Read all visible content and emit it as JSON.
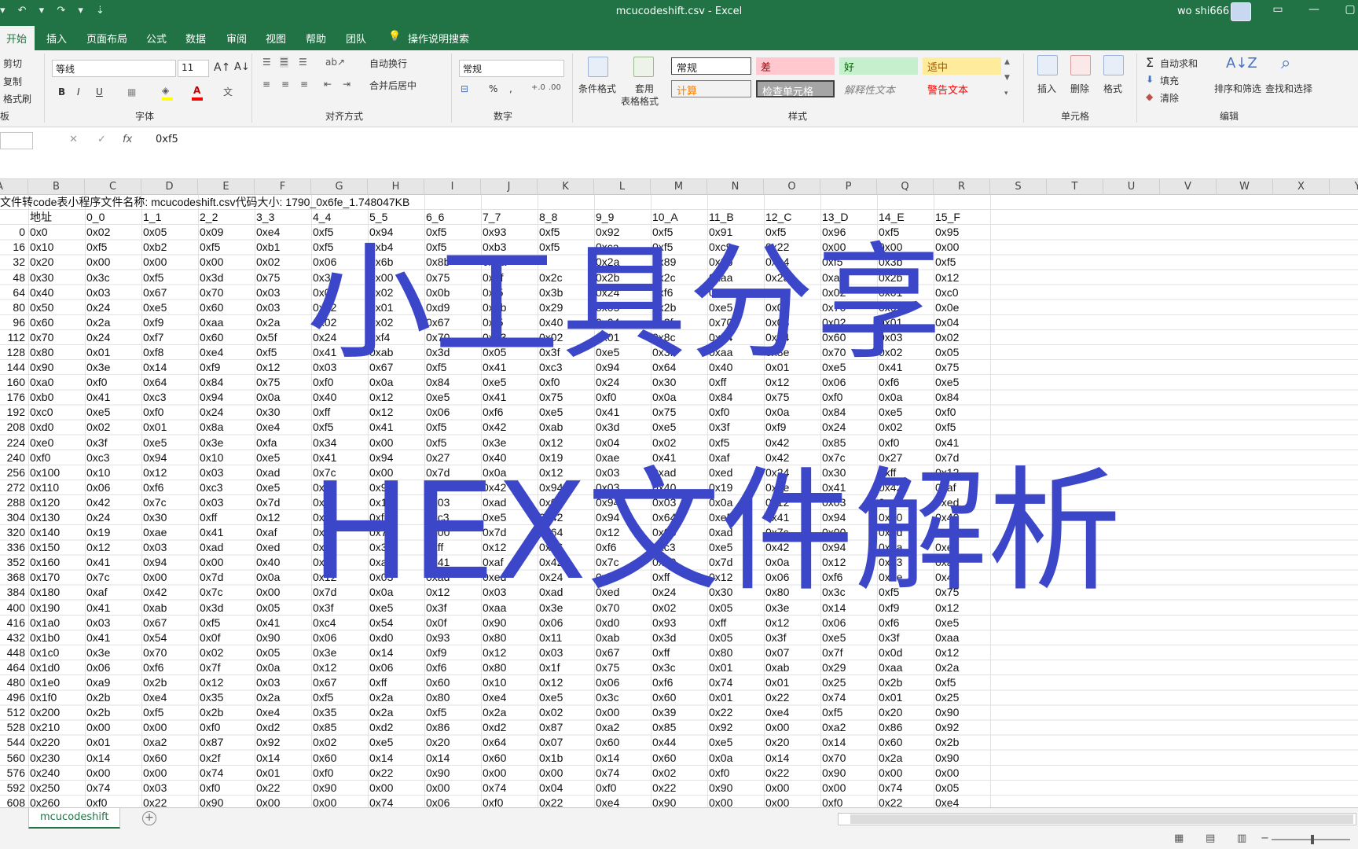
{
  "window": {
    "title": "mcucodeshift.csv  -  Excel",
    "user": "wo shi666",
    "qat": "▾ ↶ ▾ ↷ ▾ ⇣"
  },
  "ribbon_tabs": [
    {
      "label": "开始",
      "active": true
    },
    {
      "label": "插入"
    },
    {
      "label": "页面布局"
    },
    {
      "label": "公式"
    },
    {
      "label": "数据"
    },
    {
      "label": "审阅"
    },
    {
      "label": "视图"
    },
    {
      "label": "帮助"
    },
    {
      "label": "团队"
    },
    {
      "label": "操作说明搜索"
    }
  ],
  "ribbon": {
    "clipboard": {
      "cut": "剪切",
      "copy": "复制",
      "painter": "格式刷",
      "group": "板"
    },
    "font": {
      "name": "等线",
      "size": "11",
      "group": "字体",
      "bold": "B",
      "italic": "I",
      "underline": "U"
    },
    "align": {
      "wrap": "自动换行",
      "merge": "合并后居中",
      "group": "对齐方式"
    },
    "number": {
      "format": "常规",
      "group": "数字",
      "percent": "%",
      "comma": ","
    },
    "styles": {
      "conditional": "条件格式",
      "table_format_1": "套用",
      "table_format_2": "表格格式",
      "normal": "常规",
      "bad": "差",
      "good": "好",
      "neutral": "适中",
      "calc": "计算",
      "check": "检查单元格",
      "explain": "解释性文本",
      "warning": "警告文本",
      "group": "样式"
    },
    "cells": {
      "insert": "插入",
      "delete": "删除",
      "format": "格式",
      "group": "单元格"
    },
    "editing": {
      "autosum": "自动求和",
      "fill": "填充",
      "clear": "清除",
      "sort": "排序和筛选",
      "find": "查找和选择",
      "group": "编辑"
    }
  },
  "formula_bar": {
    "cancel": "✕",
    "enter": "✓",
    "fx": "fx",
    "value": "0xf5"
  },
  "columns": [
    "A",
    "B",
    "C",
    "D",
    "E",
    "F",
    "G",
    "H",
    "I",
    "J",
    "K",
    "L",
    "M",
    "N",
    "O",
    "P",
    "Q",
    "R",
    "S",
    "T",
    "U",
    "V",
    "W",
    "X",
    "Y"
  ],
  "info_line": "文件转code表小程序文件名称:   mcucodeshift.csv代码大小:   1790_0x6fe_1.748047KB",
  "header_row": [
    "",
    "地址",
    "0_0",
    "1_1",
    "2_2",
    "3_3",
    "4_4",
    "5_5",
    "6_6",
    "7_7",
    "8_8",
    "9_9",
    "10_A",
    "11_B",
    "12_C",
    "13_D",
    "14_E",
    "15_F"
  ],
  "rows": [
    [
      "0",
      "0x0",
      "0x02",
      "0x05",
      "0x09",
      "0xe4",
      "0xf5",
      "0x94",
      "0xf5",
      "0x93",
      "0xf5",
      "0x92",
      "0xf5",
      "0x91",
      "0xf5",
      "0x96",
      "0xf5",
      "0x95"
    ],
    [
      "16",
      "0x10",
      "0xf5",
      "0xb2",
      "0xf5",
      "0xb1",
      "0xf5",
      "0xb4",
      "0xf5",
      "0xb3",
      "0xf5",
      "0xca",
      "0xf5",
      "0xc9",
      "0x22",
      "0x00",
      "0x00",
      "0x00"
    ],
    [
      "32",
      "0x20",
      "0x00",
      "0x00",
      "0x00",
      "0x02",
      "0x06",
      "0x6b",
      "0x8b",
      "0x2a",
      "",
      "0x2a",
      "0x89",
      "0x2b",
      "0xe4",
      "0xf5",
      "0x3b",
      "0xf5"
    ],
    [
      "48",
      "0x30",
      "0x3c",
      "0xf5",
      "0x3d",
      "0x75",
      "0x3e",
      "0x00",
      "0x75",
      "0x3f",
      "0x2c",
      "0x2b",
      "0x2c",
      "0xaa",
      "0x2a",
      "0xa9",
      "0x2b",
      "0x12"
    ],
    [
      "64",
      "0x40",
      "0x03",
      "0x67",
      "0x70",
      "0x03",
      "0x02",
      "0x02",
      "0x0b",
      "0xf5",
      "0x3b",
      "0x24",
      "0xf6",
      "0x62",
      "0x03",
      "0x02",
      "0x01",
      "0xc0"
    ],
    [
      "80",
      "0x50",
      "0x24",
      "0xe5",
      "0x60",
      "0x03",
      "0x02",
      "0x01",
      "0xd9",
      "0xab",
      "0x29",
      "0x05",
      "0x2b",
      "0xe5",
      "0x01",
      "0x70",
      "0x02",
      "0x0e"
    ],
    [
      "96",
      "0x60",
      "0x2a",
      "0xf9",
      "0xaa",
      "0x2a",
      "0x02",
      "0x02",
      "0x67",
      "0xf5",
      "0x40",
      "0x04",
      "0x2f",
      "0x70",
      "0x03",
      "0x02",
      "0x01",
      "0x04"
    ],
    [
      "112",
      "0x70",
      "0x24",
      "0xf7",
      "0x60",
      "0x5f",
      "0x24",
      "0xf4",
      "0x70",
      "0x03",
      "0x02",
      "0x01",
      "0x8c",
      "0x24",
      "0x14",
      "0x60",
      "0x03",
      "0x02"
    ],
    [
      "128",
      "0x80",
      "0x01",
      "0xf8",
      "0xe4",
      "0xf5",
      "0x41",
      "0xab",
      "0x3d",
      "0x05",
      "0x3f",
      "0xe5",
      "0x3f",
      "0xaa",
      "0x3e",
      "0x70",
      "0x02",
      "0x05"
    ],
    [
      "144",
      "0x90",
      "0x3e",
      "0x14",
      "0xf9",
      "0x12",
      "0x03",
      "0x67",
      "0xf5",
      "0x41",
      "0xc3",
      "0x94",
      "0x64",
      "0x40",
      "0x01",
      "0xe5",
      "0x41",
      "0x75"
    ],
    [
      "160",
      "0xa0",
      "0xf0",
      "0x64",
      "0x84",
      "0x75",
      "0xf0",
      "0x0a",
      "0x84",
      "0xe5",
      "0xf0",
      "0x24",
      "0x30",
      "0xff",
      "0x12",
      "0x06",
      "0xf6",
      "0xe5"
    ],
    [
      "176",
      "0xb0",
      "0x41",
      "0xc3",
      "0x94",
      "0x0a",
      "0x40",
      "0x12",
      "0xe5",
      "0x41",
      "0x75",
      "0xf0",
      "0x0a",
      "0x84",
      "0x75",
      "0xf0",
      "0x0a",
      "0x84"
    ],
    [
      "192",
      "0xc0",
      "0xe5",
      "0xf0",
      "0x24",
      "0x30",
      "0xff",
      "0x12",
      "0x06",
      "0xf6",
      "0xe5",
      "0x41",
      "0x75",
      "0xf0",
      "0x0a",
      "0x84",
      "0xe5",
      "0xf0"
    ],
    [
      "208",
      "0xd0",
      "0x02",
      "0x01",
      "0x8a",
      "0xe4",
      "0xf5",
      "0x41",
      "0xf5",
      "0x42",
      "0xab",
      "0x3d",
      "0xe5",
      "0x3f",
      "0xf9",
      "0x24",
      "0x02",
      "0xf5"
    ],
    [
      "224",
      "0xe0",
      "0x3f",
      "0xe5",
      "0x3e",
      "0xfa",
      "0x34",
      "0x00",
      "0xf5",
      "0x3e",
      "0x12",
      "0x04",
      "0x02",
      "0xf5",
      "0x42",
      "0x85",
      "0xf0",
      "0x41"
    ],
    [
      "240",
      "0xf0",
      "0xc3",
      "0x94",
      "0x10",
      "0xe5",
      "0x41",
      "0x94",
      "0x27",
      "0x40",
      "0x19",
      "0xae",
      "0x41",
      "0xaf",
      "0x42",
      "0x7c",
      "0x27",
      "0x7d"
    ],
    [
      "256",
      "0x100",
      "0x10",
      "0x12",
      "0x03",
      "0xad",
      "0x7c",
      "0x00",
      "0x7d",
      "0x0a",
      "0x12",
      "0x03",
      "0xad",
      "0xed",
      "0x24",
      "0x30",
      "0xff",
      "0x12"
    ],
    [
      "272",
      "0x110",
      "0x06",
      "0xf6",
      "0xc3",
      "0xe5",
      "0x02",
      "0x94",
      "0x40",
      "0x42",
      "0x94",
      "0x03",
      "0x40",
      "0x19",
      "0xae",
      "0x41",
      "0x42",
      "0xaf"
    ],
    [
      "288",
      "0x120",
      "0x42",
      "0x7c",
      "0x03",
      "0x7d",
      "0xe8",
      "0x12",
      "0x03",
      "0xad",
      "0x0c",
      "0x94",
      "0x03",
      "0x0a",
      "0x12",
      "0x03",
      "0xad",
      "0xed"
    ],
    [
      "304",
      "0x130",
      "0x24",
      "0x30",
      "0xff",
      "0x12",
      "0x06",
      "0xf6",
      "0xc3",
      "0xe5",
      "0x42",
      "0x94",
      "0x64",
      "0xe5",
      "0x41",
      "0x94",
      "0x00",
      "0x40"
    ],
    [
      "320",
      "0x140",
      "0x19",
      "0xae",
      "0x41",
      "0xaf",
      "0x42",
      "0x7c",
      "0x00",
      "0x7d",
      "0x64",
      "0x12",
      "0x03",
      "0xad",
      "0x7c",
      "0x00",
      "0x7d",
      "0x0a"
    ],
    [
      "336",
      "0x150",
      "0x12",
      "0x03",
      "0xad",
      "0xed",
      "0x24",
      "0x30",
      "0xff",
      "0x12",
      "0x06",
      "0xf6",
      "0xc3",
      "0xe5",
      "0x42",
      "0x94",
      "0x0a",
      "0xe5"
    ],
    [
      "352",
      "0x160",
      "0x41",
      "0x94",
      "0x00",
      "0x40",
      "0x09",
      "0xae",
      "0x41",
      "0xaf",
      "0x42",
      "0x7c",
      "0x00",
      "0x7d",
      "0x0a",
      "0x12",
      "0x03",
      "0xad"
    ],
    [
      "368",
      "0x170",
      "0x7c",
      "0x00",
      "0x7d",
      "0x0a",
      "0x12",
      "0x03",
      "0xad",
      "0xed",
      "0x24",
      "0x30",
      "0xff",
      "0x12",
      "0x06",
      "0xf6",
      "0xae",
      "0x41"
    ],
    [
      "384",
      "0x180",
      "0xaf",
      "0x42",
      "0x7c",
      "0x00",
      "0x7d",
      "0x0a",
      "0x12",
      "0x03",
      "0xad",
      "0xed",
      "0x24",
      "0x30",
      "0x80",
      "0x3c",
      "0xf5",
      "0x75"
    ],
    [
      "400",
      "0x190",
      "0x41",
      "0xab",
      "0x3d",
      "0x05",
      "0x3f",
      "0xe5",
      "0x3f",
      "0xaa",
      "0x3e",
      "0x70",
      "0x02",
      "0x05",
      "0x3e",
      "0x14",
      "0xf9",
      "0x12"
    ],
    [
      "416",
      "0x1a0",
      "0x03",
      "0x67",
      "0xf5",
      "0x41",
      "0xc4",
      "0x54",
      "0x0f",
      "0x90",
      "0x06",
      "0xd0",
      "0x93",
      "0xff",
      "0x12",
      "0x06",
      "0xf6",
      "0xe5"
    ],
    [
      "432",
      "0x1b0",
      "0x41",
      "0x54",
      "0x0f",
      "0x90",
      "0x06",
      "0xd0",
      "0x93",
      "0x80",
      "0x11",
      "0xab",
      "0x3d",
      "0x05",
      "0x3f",
      "0xe5",
      "0x3f",
      "0xaa"
    ],
    [
      "448",
      "0x1c0",
      "0x3e",
      "0x70",
      "0x02",
      "0x05",
      "0x3e",
      "0x14",
      "0xf9",
      "0x12",
      "0x03",
      "0x67",
      "0xff",
      "0x80",
      "0x07",
      "0x7f",
      "0x0d",
      "0x12"
    ],
    [
      "464",
      "0x1d0",
      "0x06",
      "0xf6",
      "0x7f",
      "0x0a",
      "0x12",
      "0x06",
      "0xf6",
      "0x80",
      "0x1f",
      "0x75",
      "0x3c",
      "0x01",
      "0xab",
      "0x29",
      "0xaa",
      "0x2a"
    ],
    [
      "480",
      "0x1e0",
      "0xa9",
      "0x2b",
      "0x12",
      "0x03",
      "0x67",
      "0xff",
      "0x60",
      "0x10",
      "0x12",
      "0x06",
      "0xf6",
      "0x74",
      "0x01",
      "0x25",
      "0x2b",
      "0xf5"
    ],
    [
      "496",
      "0x1f0",
      "0x2b",
      "0xe4",
      "0x35",
      "0x2a",
      "0xf5",
      "0x2a",
      "0x80",
      "0xe4",
      "0xe5",
      "0x3c",
      "0x60",
      "0x01",
      "0x22",
      "0x74",
      "0x01",
      "0x25"
    ],
    [
      "512",
      "0x200",
      "0x2b",
      "0xf5",
      "0x2b",
      "0xe4",
      "0x35",
      "0x2a",
      "0xf5",
      "0x2a",
      "0x02",
      "0x00",
      "0x39",
      "0x22",
      "0xe4",
      "0xf5",
      "0x20",
      "0x90"
    ],
    [
      "528",
      "0x210",
      "0x00",
      "0x00",
      "0xf0",
      "0xd2",
      "0x85",
      "0xd2",
      "0x86",
      "0xd2",
      "0x87",
      "0xa2",
      "0x85",
      "0x92",
      "0x00",
      "0xa2",
      "0x86",
      "0x92"
    ],
    [
      "544",
      "0x220",
      "0x01",
      "0xa2",
      "0x87",
      "0x92",
      "0x02",
      "0xe5",
      "0x20",
      "0x64",
      "0x07",
      "0x60",
      "0x44",
      "0xe5",
      "0x20",
      "0x14",
      "0x60",
      "0x2b"
    ],
    [
      "560",
      "0x230",
      "0x14",
      "0x60",
      "0x2f",
      "0x14",
      "0x60",
      "0x14",
      "0x14",
      "0x60",
      "0x1b",
      "0x14",
      "0x60",
      "0x0a",
      "0x14",
      "0x70",
      "0x2a",
      "0x90"
    ],
    [
      "576",
      "0x240",
      "0x00",
      "0x00",
      "0x74",
      "0x01",
      "0xf0",
      "0x22",
      "0x90",
      "0x00",
      "0x00",
      "0x74",
      "0x02",
      "0xf0",
      "0x22",
      "0x90",
      "0x00",
      "0x00"
    ],
    [
      "592",
      "0x250",
      "0x74",
      "0x03",
      "0xf0",
      "0x22",
      "0x90",
      "0x00",
      "0x00",
      "0x74",
      "0x04",
      "0xf0",
      "0x22",
      "0x90",
      "0x00",
      "0x00",
      "0x74",
      "0x05"
    ],
    [
      "608",
      "0x260",
      "0xf0",
      "0x22",
      "0x90",
      "0x00",
      "0x00",
      "0x74",
      "0x06",
      "0xf0",
      "0x22",
      "0xe4",
      "0x90",
      "0x00",
      "0x00",
      "0xf0",
      "0x22",
      "0xe4"
    ]
  ],
  "overlay": {
    "line1": "小工具分享",
    "line2": "HEX文件解析"
  },
  "sheet": {
    "name": "mcucodeshift",
    "add": "+"
  }
}
